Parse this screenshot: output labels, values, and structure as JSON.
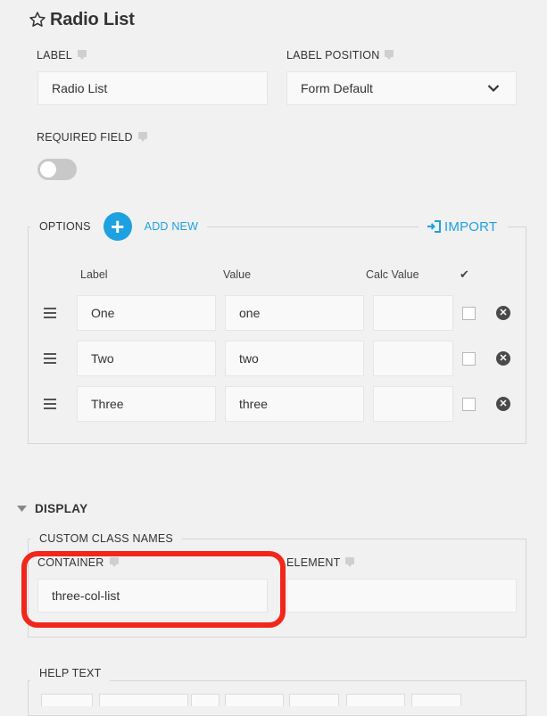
{
  "title": "Radio List",
  "label_field": {
    "caption": "LABEL",
    "value": "Radio List"
  },
  "label_position": {
    "caption": "LABEL POSITION",
    "value": "Form Default"
  },
  "required": {
    "caption": "REQUIRED FIELD",
    "on": false
  },
  "options": {
    "caption": "OPTIONS",
    "add_new": "ADD NEW",
    "import": "IMPORT",
    "headers": {
      "label": "Label",
      "value": "Value",
      "calc": "Calc Value",
      "check": "✔"
    },
    "rows": [
      {
        "label": "One",
        "value": "one",
        "calc": ""
      },
      {
        "label": "Two",
        "value": "two",
        "calc": ""
      },
      {
        "label": "Three",
        "value": "three",
        "calc": ""
      }
    ]
  },
  "display": {
    "heading": "DISPLAY",
    "custom_class_names": "CUSTOM CLASS NAMES",
    "container": {
      "caption": "CONTAINER",
      "value": "three-col-list"
    },
    "element": {
      "caption": "ELEMENT",
      "value": ""
    }
  },
  "help_text": {
    "caption": "HELP TEXT"
  },
  "colors": {
    "accent": "#1ea1e0",
    "highlight": "#f2261b"
  }
}
